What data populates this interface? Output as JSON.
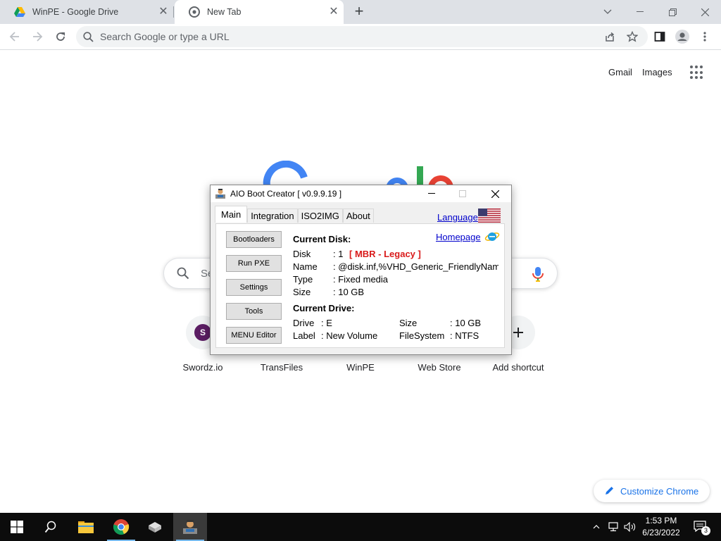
{
  "browser": {
    "tabs": [
      {
        "title": "WinPE - Google Drive",
        "active": false
      },
      {
        "title": "New Tab",
        "active": true
      }
    ],
    "omnibox_placeholder": "Search Google or type a URL"
  },
  "ntp": {
    "header_links": [
      "Gmail",
      "Images"
    ],
    "search_placeholder_partial": "Se",
    "shortcuts": [
      {
        "label": "Swordz.io",
        "icon": "letter-s",
        "initial": "S"
      },
      {
        "label": "TransFiles",
        "icon": "site"
      },
      {
        "label": "WinPE",
        "icon": "site"
      },
      {
        "label": "Web Store",
        "icon": "site"
      },
      {
        "label": "Add shortcut",
        "icon": "plus"
      }
    ],
    "customize_label": "Customize Chrome"
  },
  "dialog": {
    "title": "AIO Boot Creator [ v0.9.9.19 ]",
    "tabs": [
      "Main",
      "Integration",
      "ISO2IMG",
      "About"
    ],
    "active_tab": "Main",
    "language_link": "Language",
    "homepage_link": "Homepage",
    "buttons": [
      "Bootloaders",
      "Run PXE",
      "Settings",
      "Tools",
      "MENU Editor"
    ],
    "current_disk": {
      "heading": "Current Disk:",
      "disk_label": "Disk",
      "disk_value": ":  1",
      "disk_mode": "[ MBR - Legacy ]",
      "name_label": "Name",
      "name_value": ": @disk.inf,%VHD_Generic_FriendlyName",
      "type_label": "Type",
      "type_value": ": Fixed media",
      "size_label": "Size",
      "size_value": ": 10 GB"
    },
    "current_drive": {
      "heading": "Current Drive:",
      "drive_label": "Drive",
      "drive_value": ": E",
      "label_label": "Label",
      "label_value": ": New Volume",
      "size_label": "Size",
      "size_value": ": 10 GB",
      "fs_label": "FileSystem",
      "fs_value": ": NTFS"
    }
  },
  "taskbar": {
    "time": "1:53 PM",
    "date": "6/23/2022",
    "notification_count": "3"
  },
  "colors": {
    "accent_blue": "#1a73e8",
    "link_blue": "#0000cc",
    "mbr_red": "#d91a1a",
    "taskbar": "#0c0c0c"
  }
}
